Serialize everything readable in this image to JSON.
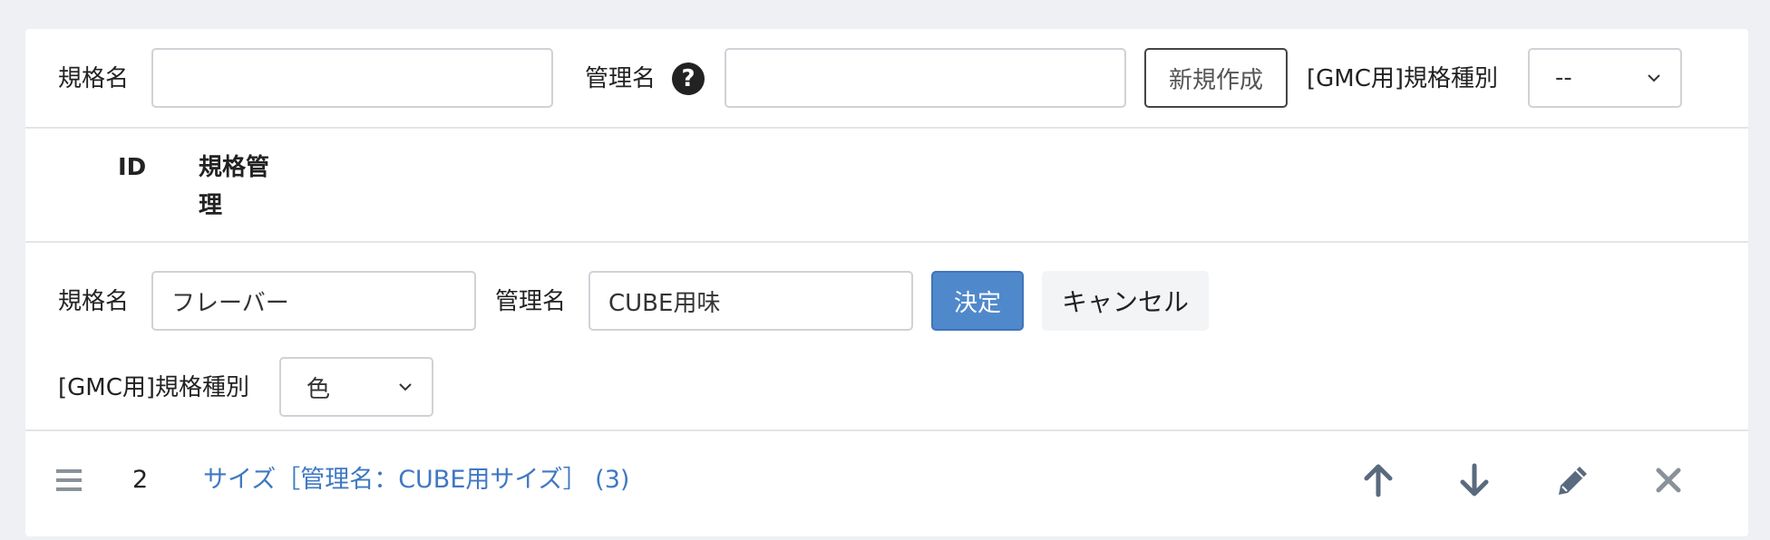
{
  "filter_row": {
    "spec_name_label": "規格名",
    "spec_name_value": "",
    "admin_name_label": "管理名",
    "admin_name_value": "",
    "help_icon_glyph": "?",
    "new_button_label": "新規作成",
    "gmc_type_label": "[GMC用]規格種別",
    "gmc_type_selected": "--"
  },
  "table_header": {
    "col_id": "ID",
    "col_spec_admin": "規格管理"
  },
  "edit_row": {
    "spec_name_label": "規格名",
    "spec_name_value": "フレーバー",
    "admin_name_label": "管理名",
    "admin_name_value": "CUBE用味",
    "confirm_button_label": "決定",
    "cancel_button_label": "キャンセル",
    "gmc_type_label": "[GMC用]規格種別",
    "gmc_type_selected": "色"
  },
  "list_items": [
    {
      "id": "2",
      "label": "サイズ［管理名：CUBE用サイズ］ (3)"
    }
  ],
  "colors": {
    "primary": "#5089cb",
    "link": "#3f78c2",
    "icon": "#5a6a7e"
  },
  "icons": [
    "help-icon",
    "drag-handle-icon",
    "arrow-up-icon",
    "arrow-down-icon",
    "pencil-icon",
    "close-icon",
    "chevron-down-icon"
  ]
}
